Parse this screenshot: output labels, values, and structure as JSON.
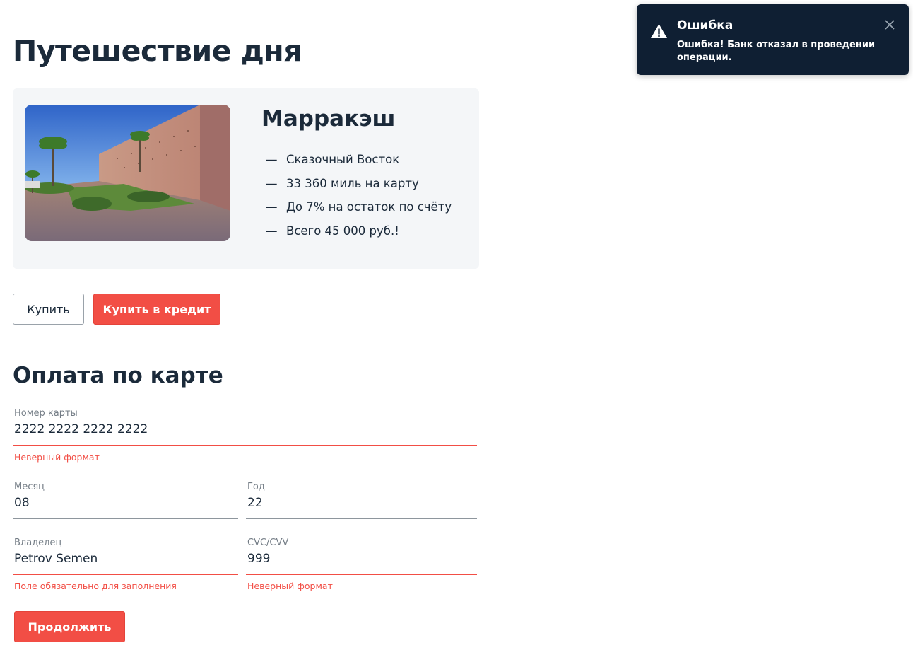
{
  "page": {
    "title": "Путешествие дня"
  },
  "tour": {
    "city": "Марракэш",
    "features": [
      "Сказочный Восток",
      "33 360 миль на карту",
      "До 7% на остаток по счёту",
      "Всего 45 000 руб.!"
    ],
    "dash": "—"
  },
  "buttons": {
    "buy": "Купить",
    "credit": "Купить в кредит",
    "continue": "Продолжить"
  },
  "payment": {
    "title": "Оплата по карте",
    "card_number": {
      "label": "Номер карты",
      "value": "2222 2222 2222 2222",
      "error": "Неверный формат"
    },
    "month": {
      "label": "Месяц",
      "value": "08"
    },
    "year": {
      "label": "Год",
      "value": "22"
    },
    "owner": {
      "label": "Владелец",
      "value": "Petrov Semen",
      "error": "Поле обязательно для заполнения"
    },
    "cvc": {
      "label": "CVC/CVV",
      "value": "999",
      "error": "Неверный формат"
    }
  },
  "toast": {
    "title": "Ошибка",
    "text": "Ошибка! Банк отказал в проведении операции.",
    "icon": "warning-icon",
    "close_icon": "close-icon"
  },
  "colors": {
    "accent": "#f24e45",
    "text": "#1b2a3a",
    "card_bg": "#f4f6f8",
    "toast_bg": "#0f1f33"
  }
}
